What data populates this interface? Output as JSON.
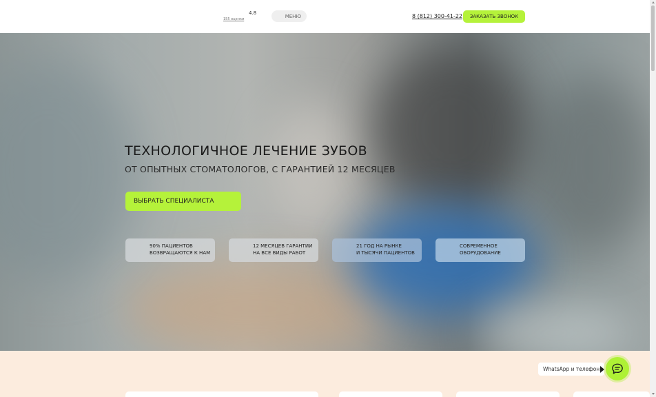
{
  "header": {
    "rating": "4.8",
    "reviews": "155 оценки",
    "menu_label": "МЕНЮ",
    "phone": "8 (812) 300-41-22",
    "call_button": "ЗАКАЗАТЬ ЗВОНОК"
  },
  "hero": {
    "title": "ТЕХНОЛОГИЧНОЕ ЛЕЧЕНИЕ ЗУБОВ",
    "subtitle": "ОТ ОПЫТНЫХ СТОМАТОЛОГОВ, С ГАРАНТИЕЙ 12 МЕСЯЦЕВ",
    "cta": "ВЫБРАТЬ СПЕЦИАЛИСТА",
    "features": [
      {
        "line1": "90% ПАЦИЕНТОВ",
        "line2": "ВОЗВРАЩАЮТСЯ К НАМ"
      },
      {
        "line1": "12 МЕСЯЦЕВ ГАРАНТИИ",
        "line2": "НА ВСЕ ВИДЫ РАБОТ"
      },
      {
        "line1": "21 ГОД НА РЫНКЕ",
        "line2": "И ТЫСЯЧИ ПАЦИЕНТОВ"
      },
      {
        "line1": "СОВРЕМЕННОЕ",
        "line2": "ОБОРУДОВАНИЕ"
      }
    ]
  },
  "contact_widget": {
    "label": "WhatsApp и телефон",
    "icon": "chat-icon"
  },
  "colors": {
    "accent": "#b5f23a",
    "bottom_bg": "#fcecde"
  }
}
